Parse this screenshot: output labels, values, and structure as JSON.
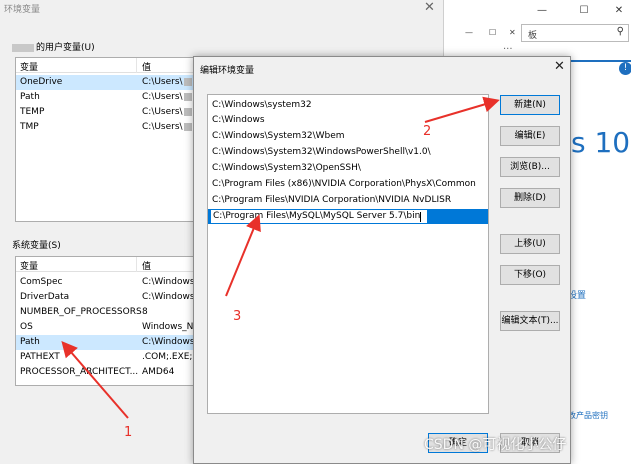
{
  "bg_settings": {
    "search_placeholder": "板",
    "search_icon": "search-icon",
    "brand_text": "s 10",
    "link_text": "设置",
    "link_text_2": "改产品密钥",
    "accent_color": "#1e6fbf"
  },
  "env_window": {
    "title": "环境变量",
    "user_group_label": "的用户变量(U)",
    "user_headers": [
      "变量",
      "值"
    ],
    "user_rows": [
      {
        "name": "OneDrive",
        "value": "C:\\Users\\"
      },
      {
        "name": "Path",
        "value": "C:\\Users\\"
      },
      {
        "name": "TEMP",
        "value": "C:\\Users\\"
      },
      {
        "name": "TMP",
        "value": "C:\\Users\\"
      }
    ],
    "system_group_label": "系统变量(S)",
    "system_headers": [
      "变量",
      "值"
    ],
    "system_rows": [
      {
        "name": "ComSpec",
        "value": "C:\\Windows"
      },
      {
        "name": "DriverData",
        "value": "C:\\Windows"
      },
      {
        "name": "NUMBER_OF_PROCESSORS",
        "value": "8"
      },
      {
        "name": "OS",
        "value": "Windows_N"
      },
      {
        "name": "Path",
        "value": "C:\\Windows"
      },
      {
        "name": "PATHEXT",
        "value": ".COM;.EXE;."
      },
      {
        "name": "PROCESSOR_ARCHITECT...",
        "value": "AMD64"
      }
    ]
  },
  "edit_dialog": {
    "title": "编辑环境变量",
    "paths": [
      "C:\\Windows\\system32",
      "C:\\Windows",
      "C:\\Windows\\System32\\Wbem",
      "C:\\Windows\\System32\\WindowsPowerShell\\v1.0\\",
      "C:\\Windows\\System32\\OpenSSH\\",
      "C:\\Program Files (x86)\\NVIDIA Corporation\\PhysX\\Common",
      "C:\\Program Files\\NVIDIA Corporation\\NVIDIA NvDLISR"
    ],
    "editing_path": "C:\\Program Files\\MySQL\\MySQL Server 5.7\\bin",
    "buttons": {
      "new": "新建(N)",
      "edit": "编辑(E)",
      "browse": "浏览(B)...",
      "delete": "删除(D)",
      "move_up": "上移(U)",
      "move_down": "下移(O)",
      "edit_text": "编辑文本(T)..."
    },
    "ok": "确定",
    "cancel": "取消",
    "selection_color": "#0078d7"
  },
  "annotations": {
    "labels": [
      "1",
      "2",
      "3"
    ],
    "color": "#e8312a"
  },
  "watermark": "CSDN @可视化小公仔"
}
